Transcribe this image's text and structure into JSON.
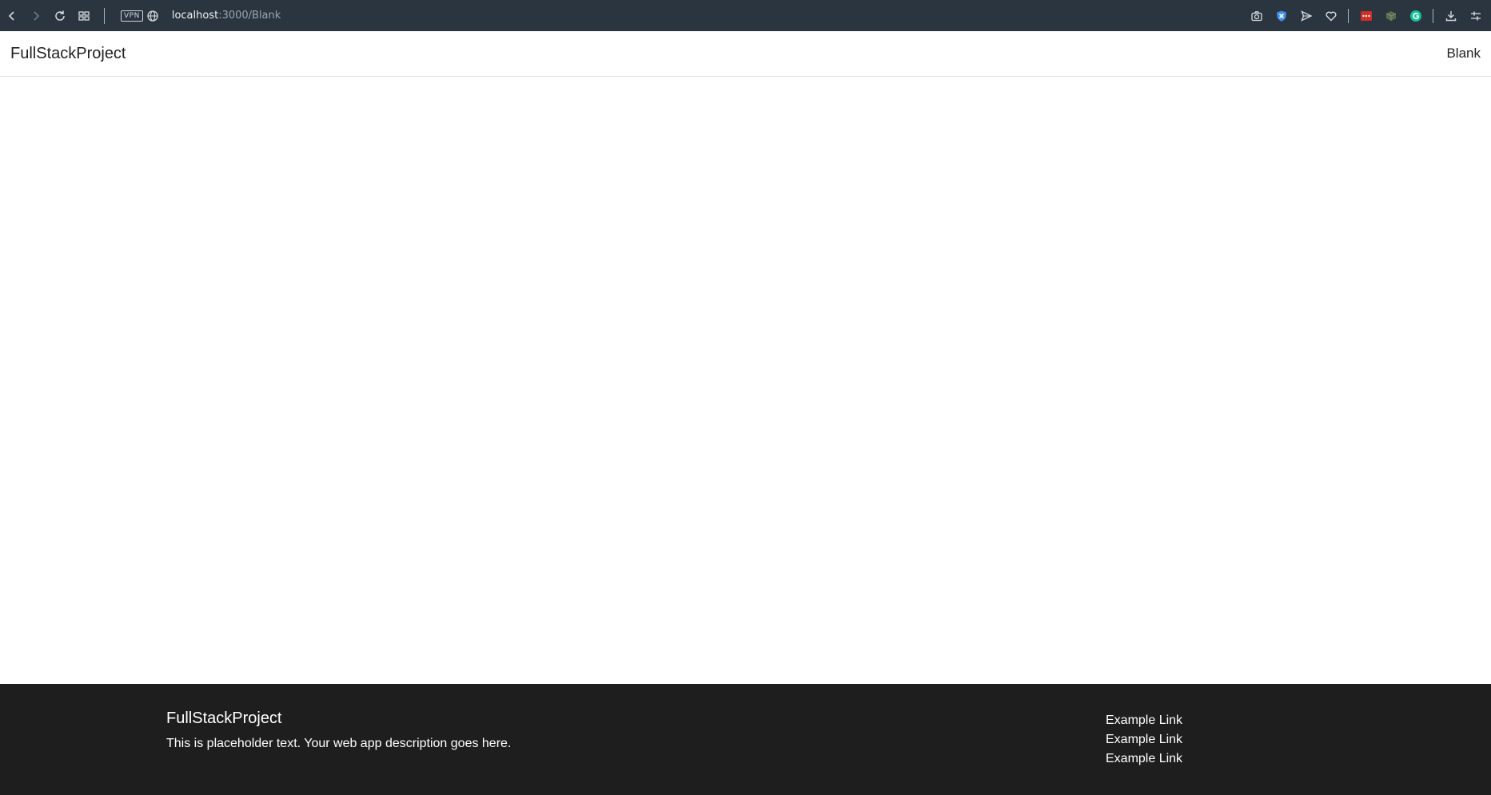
{
  "browser": {
    "vpn_label": "VPN",
    "url_host": "localhost",
    "url_path": ":3000/Blank"
  },
  "navbar": {
    "brand": "FullStackProject",
    "links": [
      {
        "label": "Blank"
      }
    ]
  },
  "footer": {
    "brand": "FullStackProject",
    "description": "This is placeholder text. Your web app description goes here.",
    "links": [
      {
        "label": "Example Link"
      },
      {
        "label": "Example Link"
      },
      {
        "label": "Example Link"
      }
    ]
  },
  "icons": {
    "nav": [
      "back-icon",
      "forward-icon",
      "reload-icon",
      "tabs-grid-icon"
    ],
    "toolbar": [
      "camera-icon",
      "shield-icon",
      "send-icon",
      "heart-icon",
      "lastpass-icon",
      "cube-icon",
      "grammarly-icon",
      "download-icon",
      "settings-icon"
    ]
  },
  "colors": {
    "browser_bar": "#2b3540",
    "footer_bg": "#1e1e1e",
    "shield_blue": "#3b8eea",
    "lastpass_red": "#d32d27",
    "grammarly_green": "#15c39a"
  }
}
